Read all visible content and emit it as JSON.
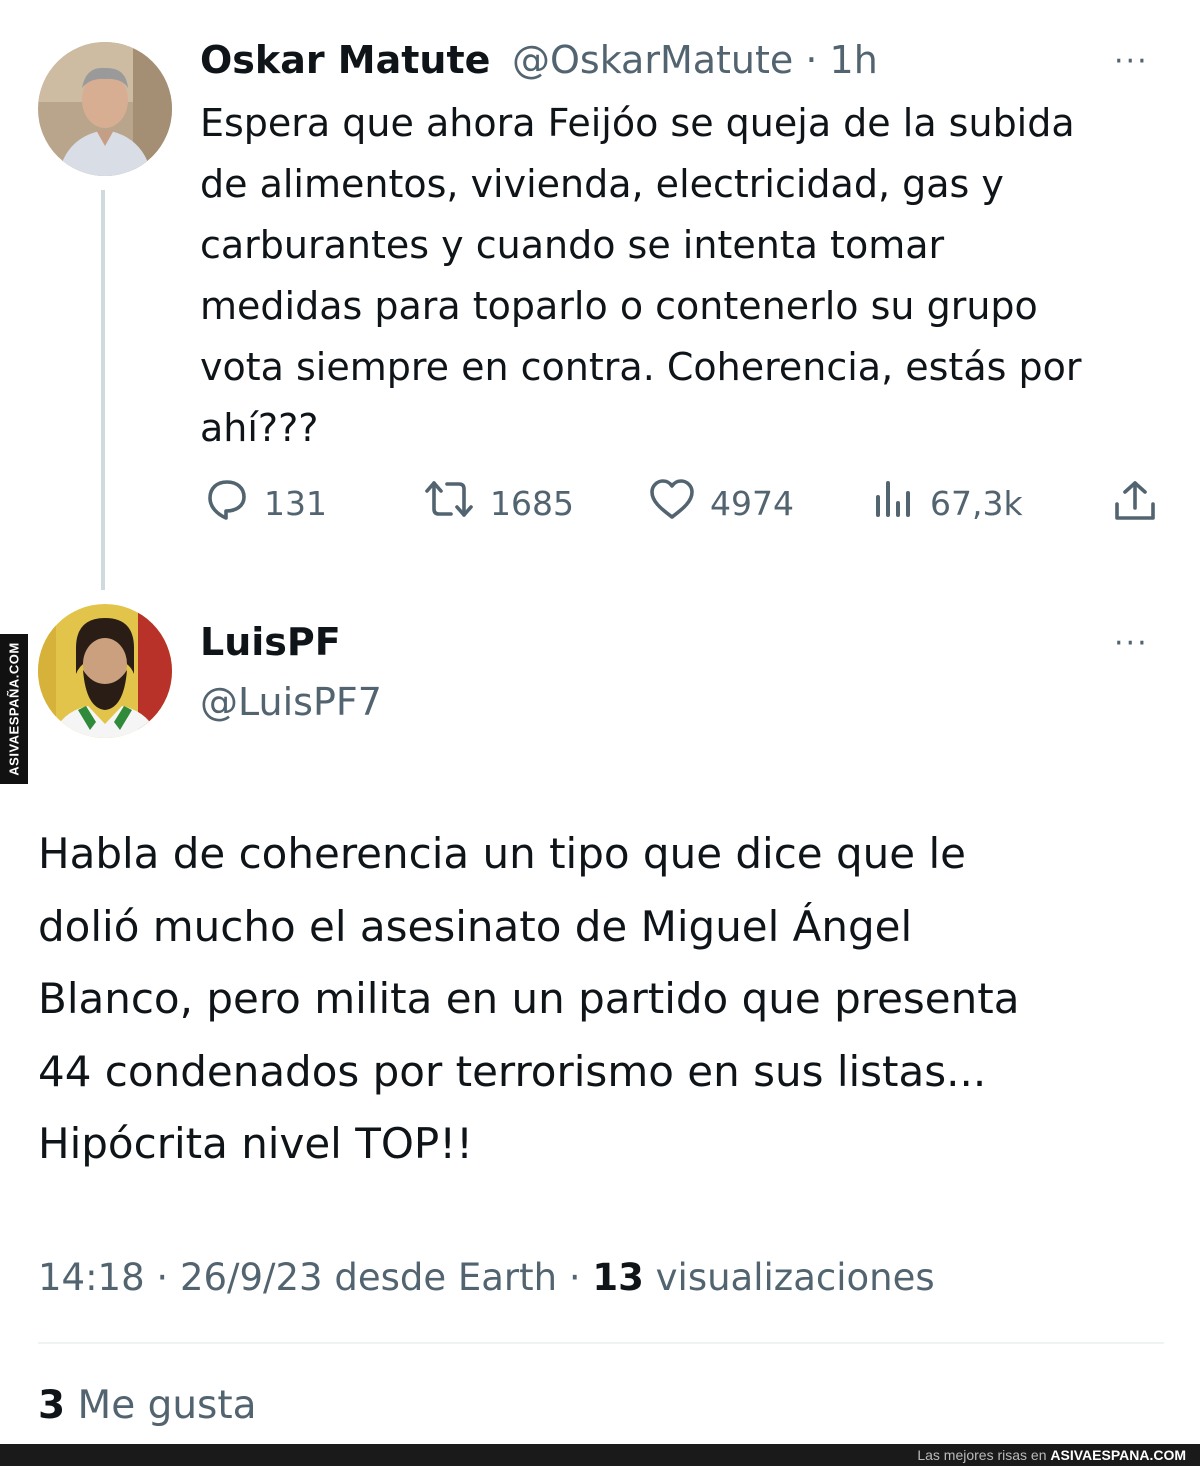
{
  "original_tweet": {
    "author_name": "Oskar Matute",
    "handle": "@OskarMatute",
    "time": "· 1h",
    "more": "···",
    "text_lines": [
      "Espera que ahora Feijóo se queja de la subida",
      "de alimentos, vivienda, electricidad, gas y",
      "carburantes y cuando se intenta tomar",
      "medidas para toparlo o contenerlo su grupo",
      "vota siempre en contra. Coherencia, estás por",
      "ahí???"
    ],
    "stats": {
      "replies": "131",
      "retweets": "1685",
      "likes": "4974",
      "views": "67,3k"
    }
  },
  "reply_tweet": {
    "author_name": "LuisPF",
    "handle": "@LuisPF7",
    "more": "···",
    "text_lines": [
      "Habla de coherencia un tipo que dice que le",
      "dolió mucho el asesinato de Miguel Ángel",
      "Blanco, pero milita en un partido que presenta",
      "44 condenados por terrorismo en sus listas...",
      "Hipócrita nivel TOP!!"
    ],
    "meta": {
      "time": "14:18",
      "date_source": "26/9/23 desde Earth",
      "separator": "·",
      "views_count": "13",
      "views_label": "visualizaciones"
    },
    "likes": {
      "count": "3",
      "label": "Me gusta"
    }
  },
  "watermark": {
    "side": "ASIVAESPAÑA.COM",
    "footer_prefix": "Las mejores risas en",
    "footer_brand": "ASIVAESPANA.COM"
  },
  "icons": [
    "reply-icon",
    "retweet-icon",
    "like-icon",
    "views-icon",
    "share-icon",
    "more-icon"
  ],
  "colors": {
    "text_primary": "#0f1419",
    "text_secondary": "#536471",
    "thread_line": "#cfd9de",
    "divider": "#eff3f4"
  }
}
